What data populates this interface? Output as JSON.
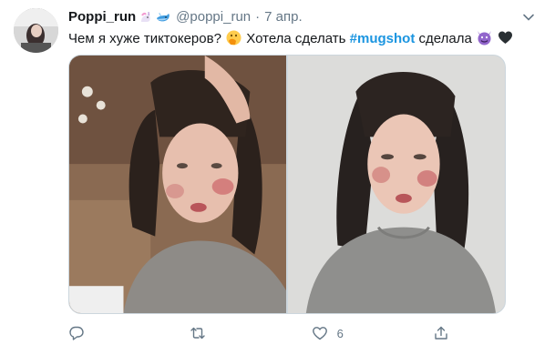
{
  "user": {
    "display_name": "Poppi_run",
    "handle": "@poppi_run",
    "separator": "·",
    "time": "7 апр."
  },
  "tweet": {
    "text_part1": "Чем я хуже тиктокеров?",
    "text_part2": "Хотела сделать",
    "hashtag": "#mugshot",
    "text_part3": "сделала"
  },
  "icons": {
    "badges": [
      "unicorn-icon",
      "whale-icon"
    ],
    "emojis": [
      "hand-over-mouth-emoji",
      "smiling-devil-emoji",
      "black-heart-emoji"
    ],
    "caret": "chevron-down-icon",
    "actions": [
      "reply-icon",
      "retweet-icon",
      "like-icon",
      "share-icon"
    ]
  },
  "actions": {
    "reply_count": "",
    "retweet_count": "",
    "like_count": "6",
    "share_count": ""
  },
  "colors": {
    "link": "#1b95e0",
    "secondary_text": "#657786",
    "border": "#ccd6dd"
  }
}
